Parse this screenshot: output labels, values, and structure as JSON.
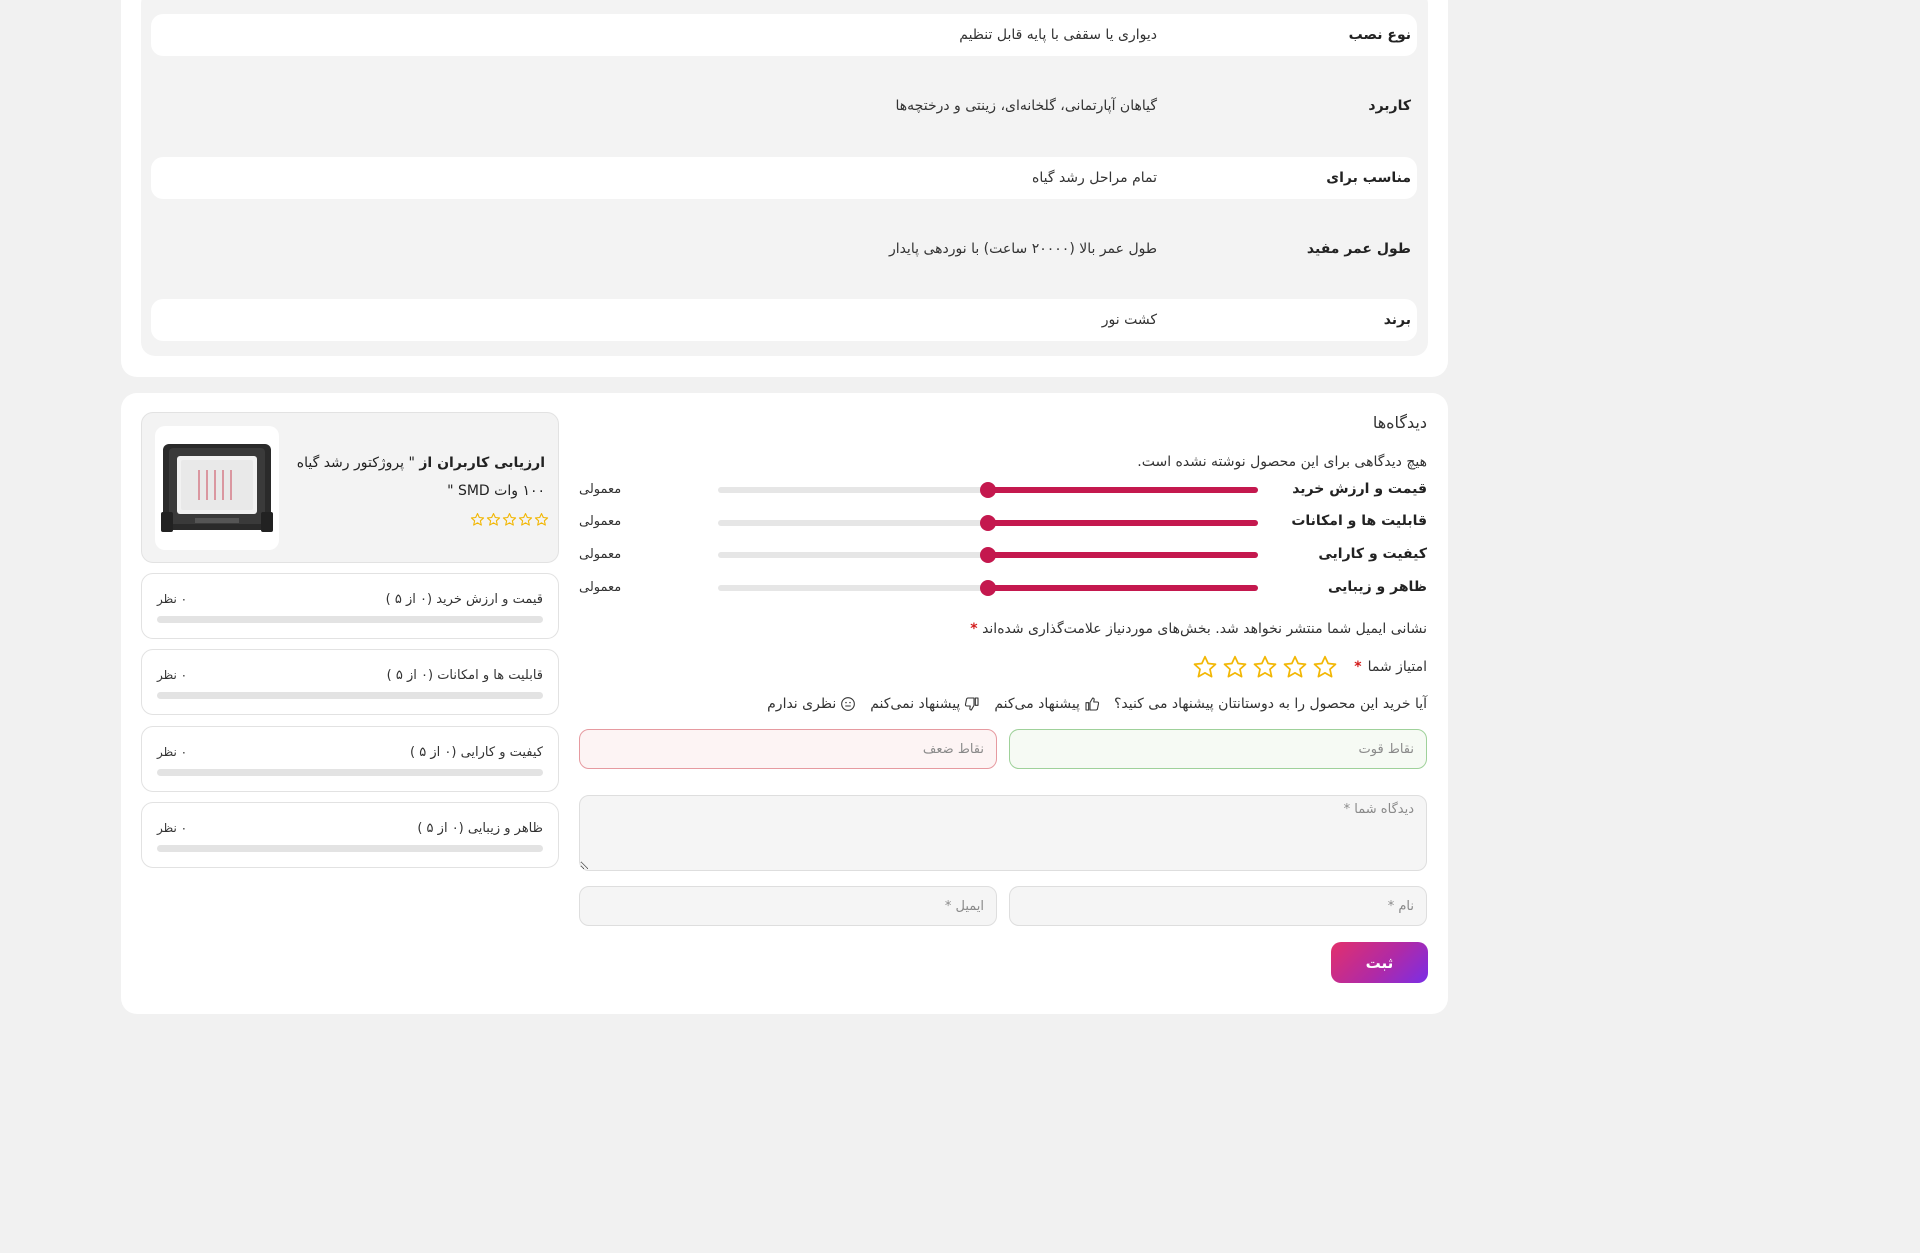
{
  "specs": [
    {
      "label": "نوع نصب",
      "value": "دیواری یا سقفی با پایه قابل تنظیم"
    },
    {
      "label": "کاربرد",
      "value": "گیاهان آپارتمانی، گلخانه‌ای، زینتی و درختچه‌ها"
    },
    {
      "label": "مناسب برای",
      "value": "تمام مراحل رشد گیاه"
    },
    {
      "label": "طول عمر مفید",
      "value": "طول عمر بالا (۲۰۰۰۰ ساعت) با نوردهی پایدار"
    },
    {
      "label": "برند",
      "value": "کشت نور"
    }
  ],
  "reviews": {
    "title": "دیدگاه‌ها",
    "no_comments": "هیچ دیدگاهی برای این محصول نوشته نشده است.",
    "ratings": [
      {
        "label": "قیمت و ارزش خرید",
        "value_text": "معمولی",
        "level": 0.5
      },
      {
        "label": "قابلیت ها و امکانات",
        "value_text": "معمولی",
        "level": 0.5
      },
      {
        "label": "کیفیت و کارایی",
        "value_text": "معمولی",
        "level": 0.5
      },
      {
        "label": "ظاهر و زیبایی",
        "value_text": "معمولی",
        "level": 0.5
      }
    ],
    "email_note": "نشانی ایمیل شما منتشر نخواهد شد. بخش‌های موردنیاز علامت‌گذاری شده‌اند",
    "required_mark": "*",
    "your_rating_label": "امتیاز شما",
    "recommend_question": "آیا خرید این محصول را به دوستانتان پیشنهاد می کنید؟",
    "recommend_options": [
      "پیشنهاد می‌کنم",
      "پیشنهاد نمی‌کنم",
      "نظری ندارم"
    ],
    "strengths_placeholder": "نقاط قوت",
    "weaknesses_placeholder": "نقاط ضعف",
    "comment_placeholder": "دیدگاه شما *",
    "name_placeholder": "نام *",
    "email_placeholder": "ایمیل *",
    "submit_label": "ثبت"
  },
  "summary": {
    "title_bold": "ارزیابی کاربران از",
    "title_rest": " \" پروژکتور رشد گیاه ۱۰۰ وات SMD \"",
    "stars": 0,
    "criteria": [
      {
        "label": "قیمت و ارزش خرید (۰ از ۵ )",
        "count": "۰ نظر"
      },
      {
        "label": "قابلیت ها و امکانات (۰ از ۵ )",
        "count": "۰ نظر"
      },
      {
        "label": "کیفیت و کارایی (۰ از ۵ )",
        "count": "۰ نظر"
      },
      {
        "label": "ظاهر و زیبایی (۰ از ۵ )",
        "count": "۰ نظر"
      }
    ]
  },
  "colors": {
    "accent": "#c4184e",
    "star": "#f2b705",
    "strengths_border": "#9fd19a",
    "weaknesses_border": "#e69aa0"
  },
  "icons": {
    "recommend": "thumbs-up-icon",
    "not_recommend": "thumbs-down-icon",
    "neutral": "neutral-face-icon",
    "star": "star-outline-icon"
  }
}
